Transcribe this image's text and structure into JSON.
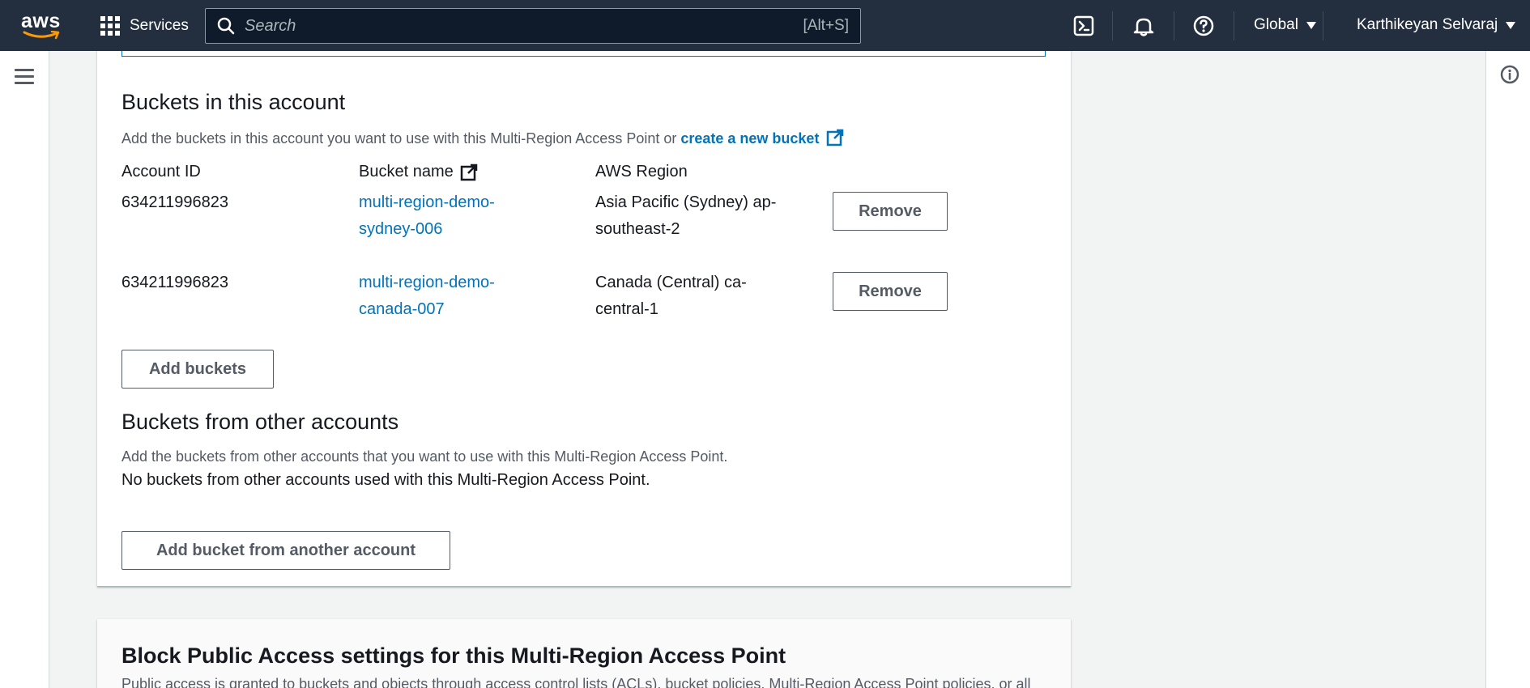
{
  "topnav": {
    "logo_text": "aws",
    "services_label": "Services",
    "search_placeholder": "Search",
    "search_shortcut": "[Alt+S]",
    "region_label": "Global",
    "user_label": "Karthikeyan Selvaraj"
  },
  "buckets_in_account": {
    "title": "Buckets in this account",
    "description_prefix": "Add the buckets in this account you want to use with this Multi-Region Access Point or ",
    "description_link": "create a new bucket",
    "columns": {
      "account_id": "Account ID",
      "bucket_name": "Bucket name",
      "region": "AWS Region"
    },
    "rows": [
      {
        "account_id": "634211996823",
        "bucket_line1": "multi-region-demo-",
        "bucket_line2": "sydney-006",
        "region_line1": "Asia Pacific (Sydney) ap-",
        "region_line2": "southeast-2",
        "remove_label": "Remove"
      },
      {
        "account_id": "634211996823",
        "bucket_line1": "multi-region-demo-",
        "bucket_line2": "canada-007",
        "region_line1": "Canada (Central) ca-",
        "region_line2": "central-1",
        "remove_label": "Remove"
      }
    ],
    "add_button": "Add buckets"
  },
  "buckets_other_accounts": {
    "title": "Buckets from other accounts",
    "description": "Add the buckets from other accounts that you want to use with this Multi-Region Access Point.",
    "empty_text": "No buckets from other accounts used with this Multi-Region Access Point.",
    "add_button": "Add bucket from another account"
  },
  "block_public_access": {
    "title": "Block Public Access settings for this Multi-Region Access Point",
    "description": "Public access is granted to buckets and objects through access control lists (ACLs), bucket policies, Multi-Region Access Point policies, or all"
  },
  "colors": {
    "nav_bg": "#232f3e",
    "link": "#0073bb",
    "aws_orange": "#ff9900"
  }
}
